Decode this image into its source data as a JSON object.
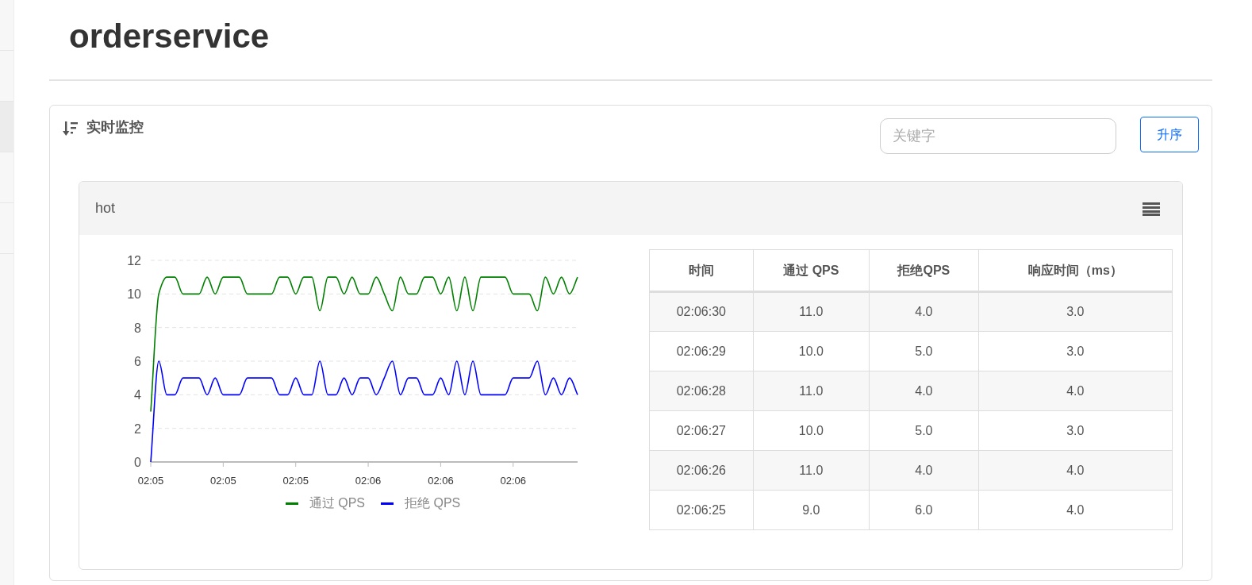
{
  "page_title": "orderservice",
  "panel": {
    "title": "实时监控",
    "search": {
      "placeholder": "关键字"
    },
    "sort_button": "升序"
  },
  "resources": [
    {
      "name": "hot",
      "chart_data": {
        "type": "line",
        "categories": [
          "02:05",
          null,
          null,
          null,
          null,
          null,
          null,
          null,
          null,
          "02:05",
          null,
          null,
          null,
          null,
          null,
          null,
          null,
          null,
          "02:05",
          null,
          null,
          null,
          null,
          null,
          null,
          null,
          null,
          "02:06",
          null,
          null,
          null,
          null,
          null,
          null,
          null,
          null,
          "02:06",
          null,
          null,
          null,
          null,
          null,
          null,
          null,
          null,
          "02:06",
          null,
          null,
          null,
          null,
          null,
          null,
          null,
          null
        ],
        "ylim": [
          0,
          12
        ],
        "grid": true,
        "legend": true,
        "yticks": [
          0,
          2,
          4,
          6,
          8,
          10,
          12
        ],
        "series": [
          {
            "name": "通过 QPS",
            "color": "#008000",
            "values": [
              3,
              10,
              11,
              11,
              10,
              10,
              10,
              11,
              10,
              11,
              11,
              11,
              10,
              10,
              10,
              10,
              11,
              11,
              10,
              11,
              11,
              9,
              11,
              11,
              10,
              11,
              10,
              10,
              11,
              10,
              9,
              11,
              10,
              10,
              11,
              11,
              10,
              11,
              9,
              11,
              9,
              11,
              11,
              11,
              11,
              10,
              10,
              10,
              9,
              11,
              10,
              11,
              10,
              11
            ]
          },
          {
            "name": "拒绝 QPS",
            "color": "#0000ff",
            "values": [
              0,
              6,
              4,
              4,
              5,
              5,
              5,
              4,
              5,
              4,
              4,
              4,
              5,
              5,
              5,
              5,
              4,
              4,
              5,
              4,
              4,
              6,
              4,
              4,
              5,
              4,
              5,
              5,
              4,
              5,
              6,
              4,
              5,
              5,
              4,
              4,
              5,
              4,
              6,
              4,
              6,
              4,
              4,
              4,
              4,
              5,
              5,
              5,
              6,
              4,
              5,
              4,
              5,
              4
            ]
          }
        ]
      },
      "table": {
        "columns": [
          "时间",
          "通过 QPS",
          "拒绝QPS",
          "响应时间（ms）"
        ],
        "rows": [
          [
            "02:06:30",
            "11.0",
            "4.0",
            "3.0"
          ],
          [
            "02:06:29",
            "10.0",
            "5.0",
            "3.0"
          ],
          [
            "02:06:28",
            "11.0",
            "4.0",
            "4.0"
          ],
          [
            "02:06:27",
            "10.0",
            "5.0",
            "3.0"
          ],
          [
            "02:06:26",
            "11.0",
            "4.0",
            "4.0"
          ],
          [
            "02:06:25",
            "9.0",
            "6.0",
            "4.0"
          ]
        ]
      }
    }
  ]
}
